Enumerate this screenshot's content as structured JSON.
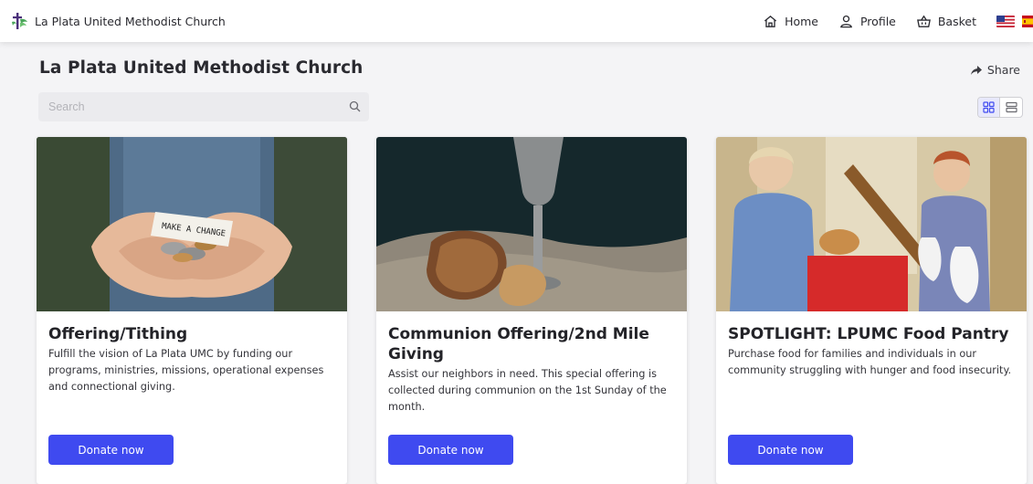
{
  "app": {
    "brand_name": "La Plata United Methodist Church"
  },
  "nav": {
    "home": "Home",
    "profile": "Profile",
    "basket": "Basket"
  },
  "page": {
    "title": "La Plata United Methodist Church",
    "share_label": "Share"
  },
  "search": {
    "placeholder": "Search",
    "value": ""
  },
  "view_toggle": {
    "selected": "grid"
  },
  "colors": {
    "accent": "#3f4af0",
    "background": "#f4f4f6",
    "card": "#ffffff"
  },
  "cards": [
    {
      "title": "Offering/Tithing",
      "description": "Fulfill the vision of La Plata UMC by funding our programs, ministries, missions, operational expenses and connectional giving.",
      "button_label": "Donate now",
      "image_text": "MAKE A CHANGE"
    },
    {
      "title": "Communion Offering/2nd Mile Giving",
      "description": "Assist our neighbors in need. This special offering is collected during communion on the 1st Sunday of the month.",
      "button_label": "Donate now"
    },
    {
      "title": "SPOTLIGHT: LPUMC Food Pantry",
      "description": "Purchase food for families and individuals in our community struggling with hunger and food insecurity.",
      "button_label": "Donate now"
    }
  ]
}
